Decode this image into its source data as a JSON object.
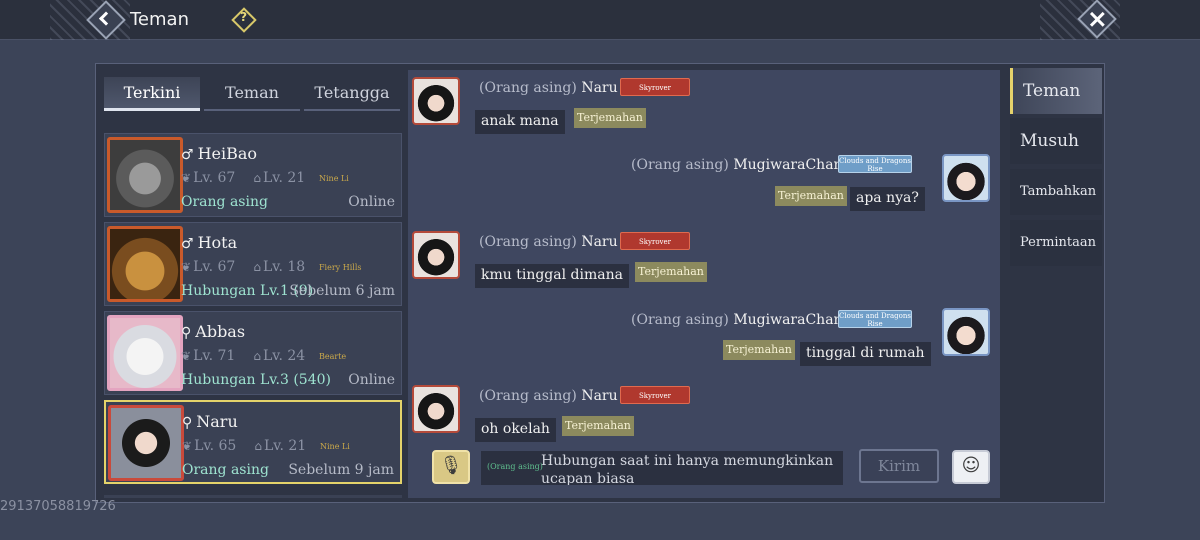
{
  "header": {
    "title": "Teman",
    "help_symbol": "?"
  },
  "left_tabs": [
    "Terkini",
    "Teman",
    "Tetangga"
  ],
  "friends": [
    {
      "name": "HeiBao",
      "gender": "♂",
      "lv_char": "Lv. 67",
      "lv_home": "Lv. 21",
      "guild": "Nine Li",
      "relation": "Orang asing",
      "status": "Online",
      "avatar": "cat-icon"
    },
    {
      "name": "Hota",
      "gender": "♂",
      "lv_char": "Lv. 67",
      "lv_home": "Lv. 18",
      "guild": "Fiery Hills",
      "relation": "Hubungan Lv.1 (9)",
      "status": "Sebelum 6 jam",
      "avatar": "dog-icon"
    },
    {
      "name": "Abbas",
      "gender": "⚲",
      "lv_char": "Lv. 71",
      "lv_home": "Lv. 24",
      "guild": "Bearte",
      "relation": "Hubungan Lv.3 (540)",
      "status": "Online",
      "avatar": "fox-icon"
    },
    {
      "name": "Naru",
      "gender": "⚲",
      "lv_char": "Lv. 65",
      "lv_home": "Lv. 21",
      "guild": "Nine Li",
      "relation": "Orang asing",
      "status": "Sebelum 9 jam",
      "avatar": "girl-icon"
    }
  ],
  "messages": [
    {
      "side": "left",
      "prefix": "(Orang asing)",
      "name": "Naru",
      "badge": "Skyrover",
      "text": "anak mana",
      "translate": "Terjemahan"
    },
    {
      "side": "right",
      "prefix": "(Orang asing)",
      "name": "MugiwaraChan",
      "badge": "Clouds and Dragons Rise",
      "text": "apa nya?",
      "translate": "Terjemahan"
    },
    {
      "side": "left",
      "prefix": "(Orang asing)",
      "name": "Naru",
      "badge": "Skyrover",
      "text": "kmu tinggal dimana",
      "translate": "Terjemahan"
    },
    {
      "side": "right",
      "prefix": "(Orang asing)",
      "name": "MugiwaraChan",
      "badge": "Clouds and Dragons Rise",
      "text": "tinggal di rumah",
      "translate": "Terjemahan"
    },
    {
      "side": "left",
      "prefix": "(Orang asing)",
      "name": "Naru",
      "badge": "Skyrover",
      "text": "oh okelah",
      "translate": "Terjemahan"
    }
  ],
  "input": {
    "prefix": "(Orang asing)",
    "placeholder": "Hubungan saat ini hanya memungkinkan ucapan biasa",
    "send_label": "Kirim"
  },
  "right_tabs": [
    "Teman",
    "Musuh",
    "Tambahkan",
    "Permintaan"
  ],
  "watermark": "29137058819726",
  "colors": {
    "accent": "#e4d36a",
    "relation": "#9ee3d0",
    "badge_red": "#b0382e",
    "badge_blue": "#6f9ec8"
  }
}
